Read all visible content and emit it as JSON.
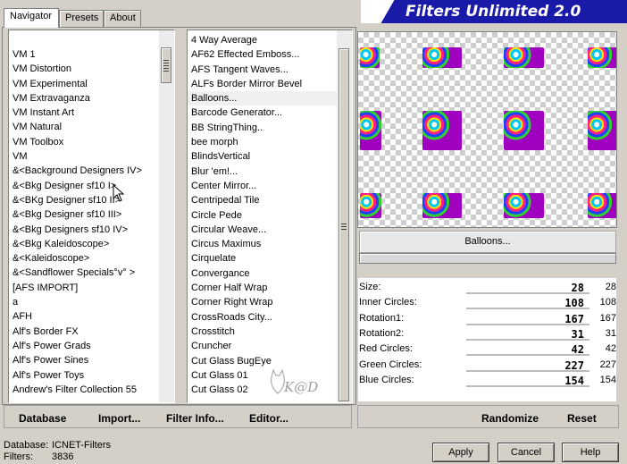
{
  "tabs": [
    {
      "label": "Navigator",
      "active": true
    },
    {
      "label": "Presets",
      "active": false
    },
    {
      "label": "About",
      "active": false
    }
  ],
  "banner": {
    "title": "Filters Unlimited 2.0"
  },
  "categories": [
    "VM 1",
    "VM Distortion",
    "VM Experimental",
    "VM Extravaganza",
    "VM Instant Art",
    "VM Natural",
    "VM Toolbox",
    "VM",
    "&<Background Designers IV>",
    "&<Bkg Designer sf10 I>",
    "&<BKg Designer sf10 II>",
    "&<Bkg Designer sf10 III>",
    "&<Bkg Designers sf10 IV>",
    "&<Bkg Kaleidoscope>",
    "&<Kaleidoscope>",
    "&<Sandflower Specials°v° >",
    "[AFS IMPORT]",
    "a",
    "AFH",
    "Alf's Border FX",
    "Alf's Power Grads",
    "Alf's Power Sines",
    "Alf's Power Toys",
    "Andrew's Filter Collection 55"
  ],
  "filters": [
    "4 Way Average",
    "AF62 Effected Emboss...",
    "AFS Tangent Waves...",
    "ALFs Border Mirror Bevel",
    "Balloons...",
    "Barcode Generator...",
    "BB StringThing..",
    "bee morph",
    "BlindsVertical",
    "Blur 'em!...",
    "Center Mirror...",
    "Centripedal Tile",
    "Circle Pede",
    "Circular Weave...",
    "Circus Maximus",
    "Cirquelate",
    "Convergance",
    "Corner Half Wrap",
    "Corner Right Wrap",
    "CrossRoads City...",
    "Crosstitch",
    "Cruncher",
    "Cut Glass  BugEye",
    "Cut Glass 01",
    "Cut Glass 02"
  ],
  "selected_filter": "Balloons...",
  "filter_name_button": "Balloons...",
  "parameters": [
    {
      "label": "Size:",
      "value": "28",
      "display": "28",
      "fraction": 0.11
    },
    {
      "label": "Inner Circles:",
      "value": "108",
      "display": "108",
      "fraction": 0.42
    },
    {
      "label": "Rotation1:",
      "value": "167",
      "display": "167",
      "fraction": 0.65
    },
    {
      "label": "Rotation2:",
      "value": "31",
      "display": "31",
      "fraction": 0.12
    },
    {
      "label": "Red Circles:",
      "value": "42",
      "display": "42",
      "fraction": 0.16
    },
    {
      "label": "Green Circles:",
      "value": "227",
      "display": "227",
      "fraction": 0.89
    },
    {
      "label": "Blue Circles:",
      "value": "154",
      "display": "154",
      "fraction": 0.6
    }
  ],
  "left_buttons": {
    "database": "Database",
    "import": "Import...",
    "filter_info": "Filter Info...",
    "editor": "Editor..."
  },
  "right_buttons": {
    "randomize": "Randomize",
    "reset": "Reset"
  },
  "status": {
    "database_label": "Database:",
    "database_value": "ICNET-Filters",
    "filters_label": "Filters:",
    "filters_value": "3836"
  },
  "dialog_buttons": {
    "apply": "Apply",
    "cancel": "Cancel",
    "help": "Help"
  },
  "watermark": "K@D"
}
